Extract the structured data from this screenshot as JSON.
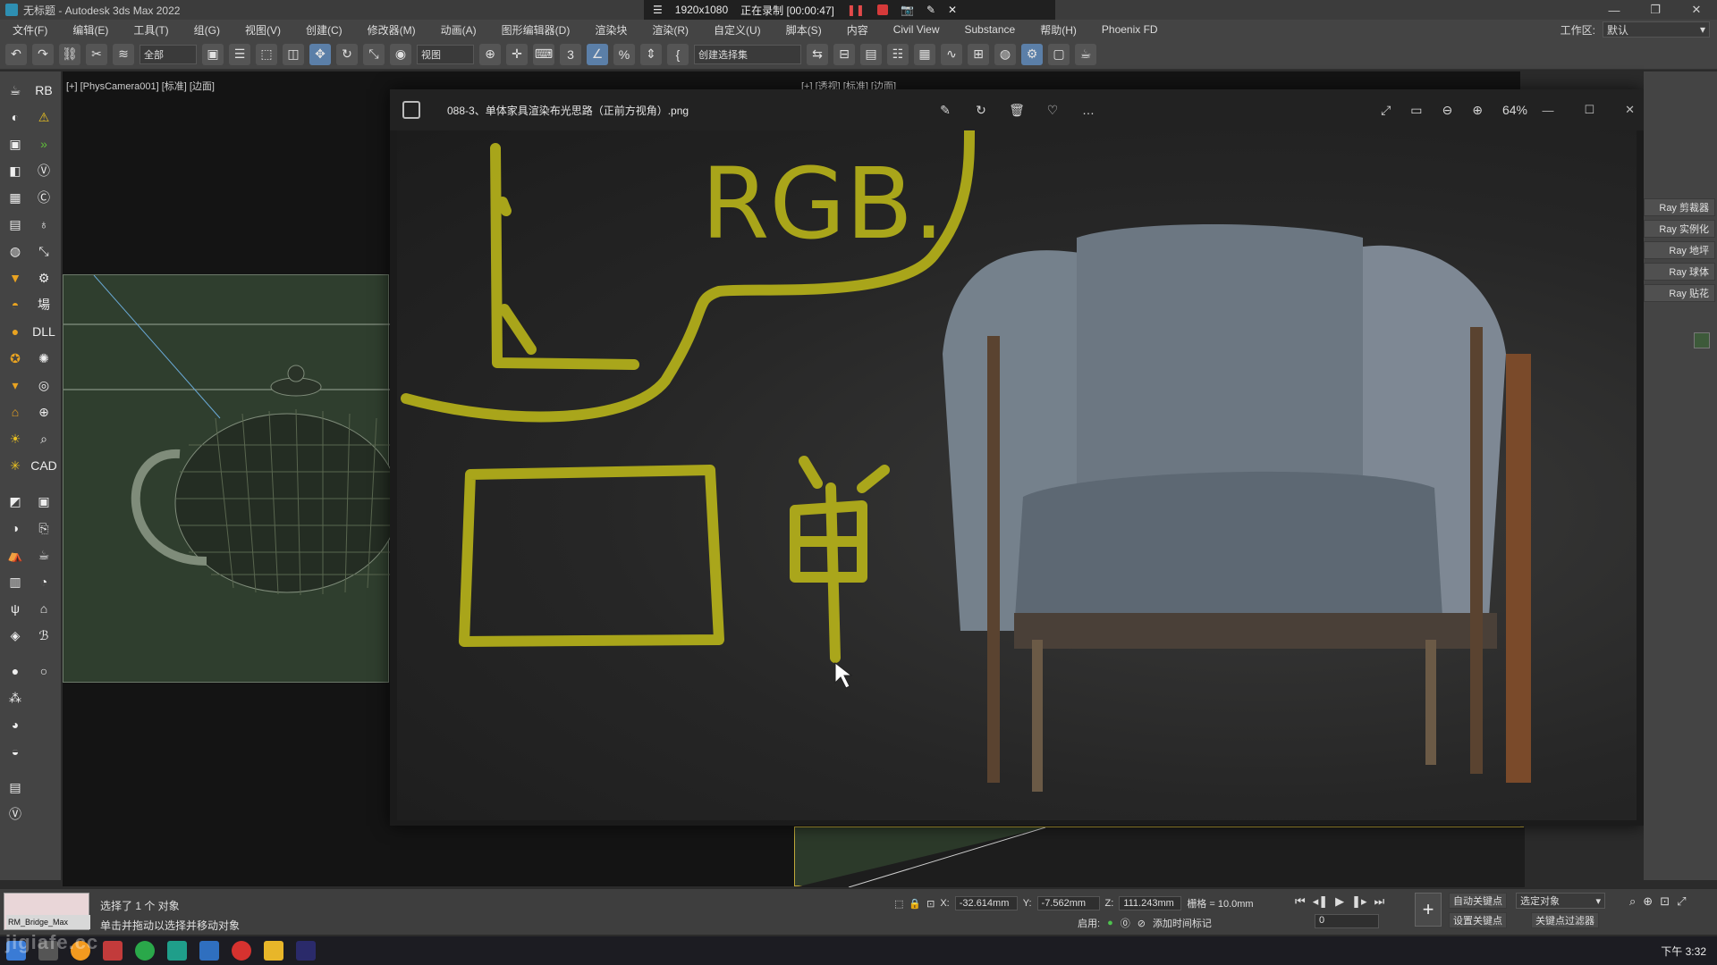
{
  "app": {
    "title": "无标题 - Autodesk 3ds Max 2022"
  },
  "recording": {
    "resolution": "1920x1080",
    "status": "正在录制 [00:00:47]"
  },
  "menu": {
    "items": [
      "文件(F)",
      "编辑(E)",
      "工具(T)",
      "组(G)",
      "视图(V)",
      "创建(C)",
      "修改器(M)",
      "动画(A)",
      "图形编辑器(D)",
      "渲染块",
      "渲染(R)",
      "自定义(U)",
      "脚本(S)",
      "内容",
      "Civil View",
      "Substance",
      "帮助(H)",
      "Phoenix FD"
    ],
    "workspace_label": "工作区:",
    "workspace_value": "默认"
  },
  "toolbar": {
    "filter_value": "全部",
    "view_value": "视图",
    "selection_set_value": "创建选择集"
  },
  "viewports": {
    "left_label": "[+] [PhysCamera001] [标准] [边面]",
    "right_label": "[+] [透视] [标准] [边面]"
  },
  "viewer": {
    "title": "088-3、单体家具渲染布光思路（正前方视角）.png",
    "zoom": "64%",
    "annotation_text_rgb": "RGB.",
    "annotation_char": "单"
  },
  "right_panel": {
    "items": [
      "Ray 剪裁器",
      "Ray 实例化",
      "Ray 地坪",
      "Ray 球体",
      "Ray 贴花"
    ]
  },
  "status": {
    "script_box_label": "RM_Bridge_Max",
    "selected_text": "选择了 1 个 对象",
    "hint_text": "单击并拖动以选择并移动对象",
    "x_label": "X:",
    "x_value": "-32.614mm",
    "y_label": "Y:",
    "y_value": "-7.562mm",
    "z_label": "Z:",
    "z_value": "111.243mm",
    "grid_text": "栅格 = 10.0mm",
    "enable_label": "启用:",
    "add_time_tag": "添加时间标记",
    "frame_value": "0",
    "auto_key": "自动关键点",
    "set_key": "设置关键点",
    "selected_object": "选定对象",
    "key_filters": "关键点过滤器"
  },
  "taskbar": {
    "clock": "下午 3:32"
  },
  "watermark": "jigiafe.cc",
  "colors": {
    "annotation": "#b8b41a",
    "recording_red": "#d63a3a",
    "active_tool": "#5b7fa8"
  }
}
